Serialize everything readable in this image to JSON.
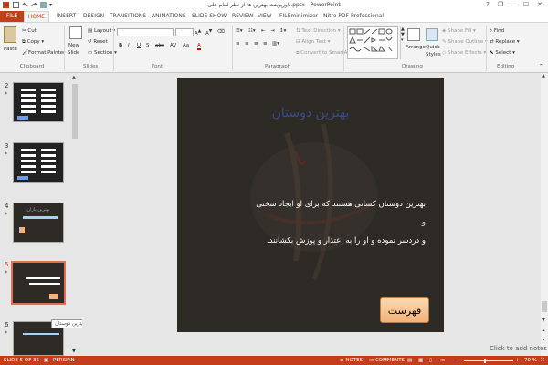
{
  "titlebar": {
    "title": "پاورپوینت بهترین ها از نظر امام علی.pptx - PowerPoint",
    "help": "?",
    "restore": "❐",
    "minimize": "—",
    "maximize": "☐",
    "close": "✕"
  },
  "tabs": {
    "file": "FILE",
    "items": [
      "HOME",
      "INSERT",
      "DESIGN",
      "TRANSITIONS",
      "ANIMATIONS",
      "SLIDE SHOW",
      "REVIEW",
      "VIEW",
      "FILEminimizer",
      "Nitro PDF Professional"
    ]
  },
  "ribbon": {
    "clipboard": {
      "label": "Clipboard",
      "paste": "Paste",
      "cut": "Cut",
      "copy": "Copy",
      "format_painter": "Format Painter"
    },
    "slides": {
      "label": "Slides",
      "new_slide": "New",
      "new_slide2": "Slide",
      "layout": "Layout",
      "reset": "Reset",
      "section": "Section"
    },
    "font": {
      "label": "Font",
      "bold": "B",
      "italic": "I",
      "underline": "U",
      "strike": "S",
      "aa": "Aa",
      "font_color": "A"
    },
    "paragraph": {
      "label": "Paragraph",
      "text_direction": "Text Direction",
      "align_text": "Align Text",
      "convert_smartart": "Convert to SmartArt"
    },
    "drawing": {
      "label": "Drawing",
      "arrange": "Arrange",
      "quick_styles": "Quick",
      "quick_styles2": "Styles",
      "shape_fill": "Shape Fill",
      "shape_outline": "Shape Outline",
      "shape_effects": "Shape Effects"
    },
    "editing": {
      "label": "Editing",
      "find": "Find",
      "replace": "Replace",
      "select": "Select"
    }
  },
  "thumbnails": {
    "nums": [
      "2",
      "3",
      "4",
      "5",
      "6"
    ],
    "star": "*",
    "t4_title": "بهترین یاران",
    "tooltip": "بهترین دوستان"
  },
  "slide": {
    "title": "بهترین دوستان",
    "body_line1": "بهترین دوستان کسانی هستند که برای او ایجاد سختی",
    "body_line2": "و",
    "body_line3": "و دردسر نموده و او را به اعتذار و پوزش بکشانند.",
    "menu_button": "فهرست"
  },
  "notes_hint": "Click to add notes",
  "status": {
    "slide": "SLIDE 5 OF 35",
    "language": "PERSIAN",
    "notes": "NOTES",
    "comments": "COMMENTS",
    "zoom": "70 %"
  },
  "colors": {
    "accent": "#c43e1c",
    "slide_bg": "#2e2a25",
    "slide_title": "#3a4a8a",
    "menu_button": "#f3b27a"
  }
}
